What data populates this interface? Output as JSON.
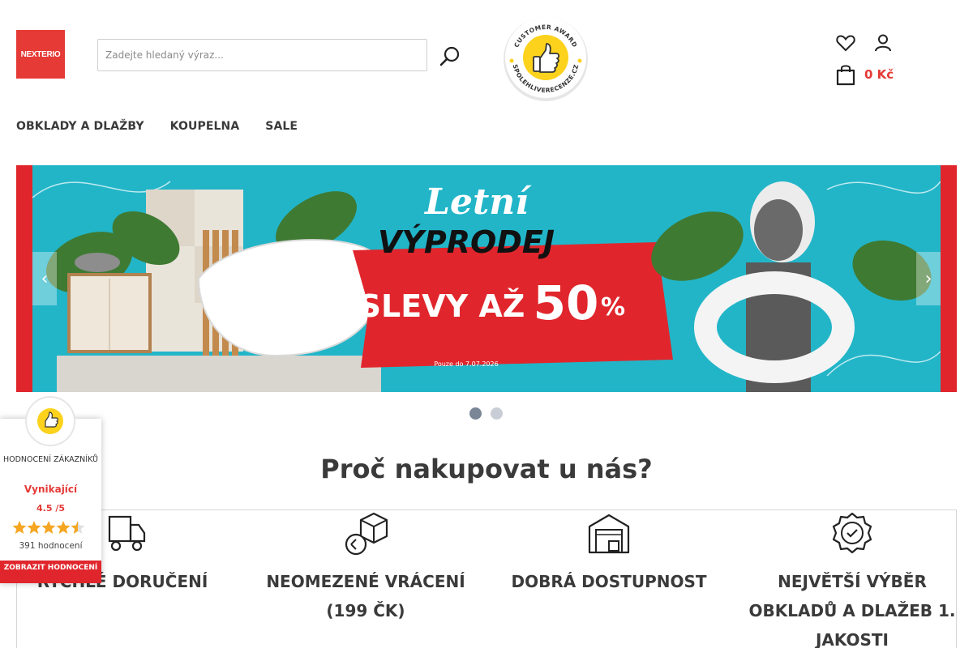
{
  "brand": {
    "logo_text": "NEXTERIO",
    "accent": "#e53a36"
  },
  "search": {
    "placeholder": "Zadejte hledaný výraz..."
  },
  "award": {
    "ring_top": "CUSTOMER AWARD",
    "ring_bottom": "SPOLEHLIVERECENZE.CZ"
  },
  "cart": {
    "amount": "0 Kč"
  },
  "nav": {
    "items": [
      "OBKLADY A DLAŽBY",
      "KOUPELNA",
      "SALE"
    ]
  },
  "banner": {
    "script_title": "Letní",
    "title": "VÝPRODEJ",
    "discount_label": "SLEVY AŽ",
    "discount_value": "50",
    "percent": "%",
    "note": "Pouze do 7.07.2026",
    "colors": {
      "background": "#22b5c8",
      "frame": "#e0262c"
    }
  },
  "slider": {
    "count": 2,
    "active": 0
  },
  "why": {
    "title": "Proč nakupovat u nás?",
    "features": [
      {
        "icon": "delivery-truck-icon",
        "label": "RYCHLÉ DORUČENÍ"
      },
      {
        "icon": "return-box-icon",
        "label": "NEOMEZENÉ VRÁCENÍ (199 ČK)"
      },
      {
        "icon": "warehouse-icon",
        "label": "DOBRÁ DOSTUPNOST"
      },
      {
        "icon": "quality-badge-icon",
        "label": "NEJVĚTŠÍ VÝBĚR OBKLADŮ A DLAŽEB 1. JAKOSTI"
      }
    ]
  },
  "rating": {
    "title": "HODNOCENÍ ZÁKAZNÍKŮ",
    "word": "Vynikající",
    "score": "4.5",
    "scale": "/5",
    "stars": 4.5,
    "count": "391 hodnocení",
    "button": "ZOBRAZIT HODNOCENÍ"
  }
}
